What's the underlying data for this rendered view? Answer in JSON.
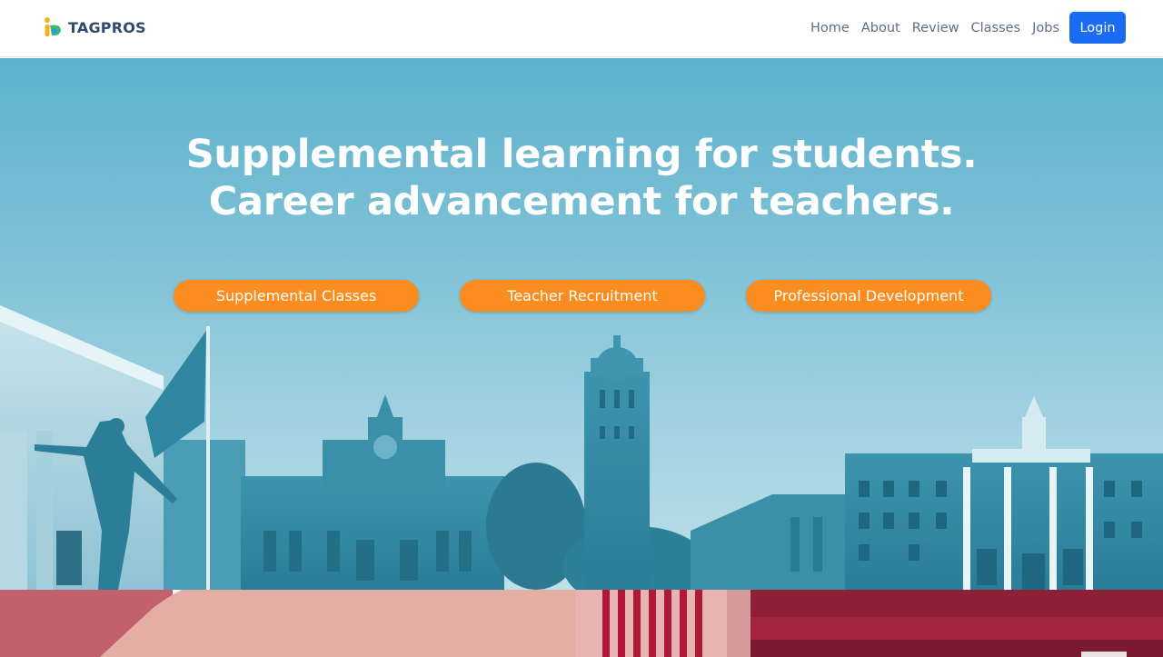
{
  "brand": {
    "name": "TAGPROS",
    "logo_icon": "tagpros-logo-icon"
  },
  "nav": {
    "items": [
      "Home",
      "About",
      "Review",
      "Classes",
      "Jobs"
    ],
    "login_label": "Login"
  },
  "hero": {
    "headline_line1": "Supplemental learning for students.",
    "headline_line2": "Career advancement for teachers.",
    "buttons": [
      "Supplemental Classes",
      "Teacher Recruitment",
      "Professional Development"
    ],
    "background_description_icon": "campus-collage-image"
  },
  "colors": {
    "nav_link": "#5b6f86",
    "brand_text": "#2f4a6e",
    "login_button": "#1a6cf2",
    "cta_button": "#fb8c1f",
    "hero_sky": "#6ab9d1",
    "building_tint": "#2f88a3"
  }
}
